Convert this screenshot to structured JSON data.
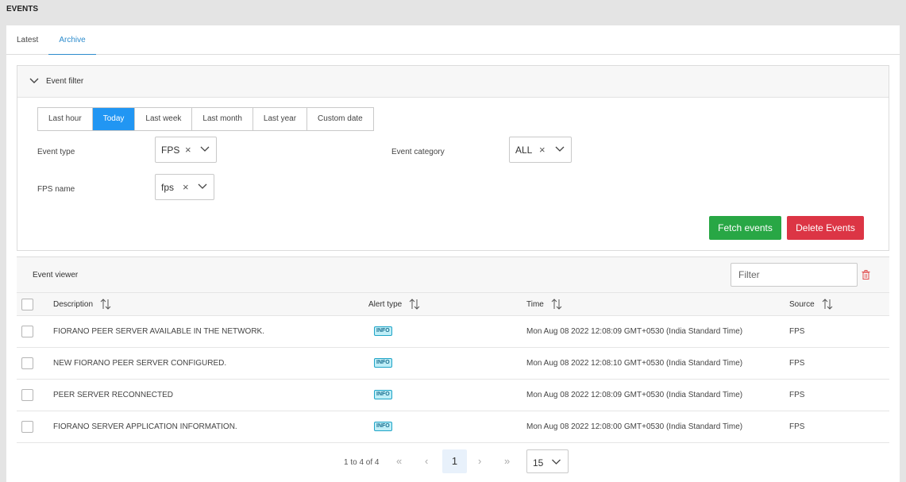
{
  "page": {
    "title": "EVENTS"
  },
  "tabs": [
    {
      "label": "Latest"
    },
    {
      "label": "Archive",
      "active": true
    }
  ],
  "filter": {
    "title": "Event filter",
    "ranges": [
      {
        "label": "Last hour"
      },
      {
        "label": "Today",
        "active": true
      },
      {
        "label": "Last week"
      },
      {
        "label": "Last month"
      },
      {
        "label": "Last year"
      },
      {
        "label": "Custom date"
      }
    ],
    "event_type": {
      "label": "Event type",
      "value": "FPS"
    },
    "event_category": {
      "label": "Event category",
      "value": "ALL"
    },
    "fps_name": {
      "label": "FPS name",
      "value": "fps"
    },
    "clear_glyph": "×",
    "fetch_label": "Fetch events",
    "delete_label": "Delete Events"
  },
  "viewer": {
    "title": "Event viewer",
    "filter_placeholder": "Filter",
    "columns": {
      "description": "Description",
      "alert_type": "Alert type",
      "time": "Time",
      "source": "Source"
    },
    "rows": [
      {
        "description": "FIORANO PEER SERVER AVAILABLE IN THE NETWORK.",
        "alert": "INFO",
        "time": "Mon Aug 08 2022 12:08:09 GMT+0530 (India Standard Time)",
        "source": "FPS"
      },
      {
        "description": "NEW FIORANO PEER SERVER CONFIGURED.",
        "alert": "INFO",
        "time": "Mon Aug 08 2022 12:08:10 GMT+0530 (India Standard Time)",
        "source": "FPS"
      },
      {
        "description": "PEER SERVER RECONNECTED",
        "alert": "INFO",
        "time": "Mon Aug 08 2022 12:08:09 GMT+0530 (India Standard Time)",
        "source": "FPS"
      },
      {
        "description": "FIORANO SERVER APPLICATION INFORMATION.",
        "alert": "INFO",
        "time": "Mon Aug 08 2022 12:08:00 GMT+0530 (India Standard Time)",
        "source": "FPS"
      }
    ]
  },
  "pagination": {
    "info": "1 to 4 of 4",
    "current_page": "1",
    "page_size": "15",
    "first_glyph": "«",
    "prev_glyph": "‹",
    "next_glyph": "›",
    "last_glyph": "»"
  },
  "colors": {
    "accent": "#2196f3",
    "fetch": "#28a745",
    "delete": "#dc3545",
    "badge_bg": "#bfeef7"
  }
}
